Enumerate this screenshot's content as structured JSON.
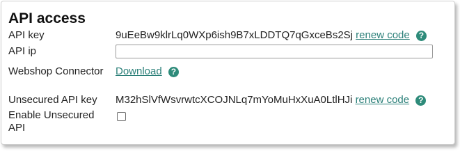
{
  "section_title": "API access",
  "api_key": {
    "label": "API key",
    "value": "9uEeBw9klrLq0WXp6ish9B7xLDDTQ7qGxceBs2Sj",
    "renew_label": "renew code",
    "help_icon": "?"
  },
  "api_ip": {
    "label": "API ip",
    "value": ""
  },
  "webshop_connector": {
    "label": "Webshop Connector",
    "download_label": "Download",
    "help_icon": "?"
  },
  "unsecured_api_key": {
    "label": "Unsecured API key",
    "value": "M32hSlVfWsvrwtcXCOJNLq7mYoMuHxXuA0LtlHJi",
    "renew_label": "renew code",
    "help_icon": "?"
  },
  "enable_unsecured_api": {
    "label": "Enable Unsecured API",
    "checked": false
  },
  "colors": {
    "link": "#2a7f78",
    "help_icon_bg": "#2e8b7a"
  }
}
